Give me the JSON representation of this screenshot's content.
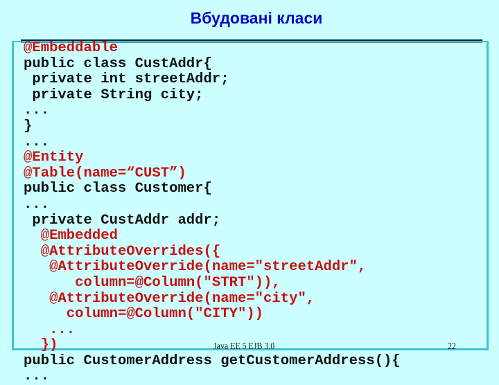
{
  "slide": {
    "title": "Вбудовані класи",
    "code_lines": [
      {
        "indent": "",
        "at": "@",
        "text": "Embeddable",
        "color": "red"
      },
      {
        "indent": "",
        "at": "",
        "text": "public class CustAddr{",
        "color": "black"
      },
      {
        "indent": " ",
        "at": "",
        "text": "private int streetAddr;",
        "color": "black"
      },
      {
        "indent": " ",
        "at": "",
        "text": "private String city;",
        "color": "black"
      },
      {
        "indent": "",
        "at": "",
        "text": "...",
        "color": "black"
      },
      {
        "indent": "",
        "at": "",
        "text": "}",
        "color": "black"
      },
      {
        "indent": "",
        "at": "",
        "text": "...",
        "color": "black"
      },
      {
        "indent": "",
        "at": "@",
        "text": "Entity",
        "color": "red"
      },
      {
        "indent": "",
        "at": "@",
        "text": "Table(name=“CUST”)",
        "color": "red"
      },
      {
        "indent": "",
        "at": "",
        "text": "public class Customer{",
        "color": "black"
      },
      {
        "indent": "",
        "at": "",
        "text": "...",
        "color": "black"
      },
      {
        "indent": " ",
        "at": "",
        "text": "private CustAddr addr;",
        "color": "black"
      },
      {
        "indent": "  ",
        "at": "@",
        "text": "Embedded",
        "color": "red"
      },
      {
        "indent": "  ",
        "at": "@",
        "text": "AttributeOverrides({",
        "color": "red"
      },
      {
        "indent": "   ",
        "at": "@",
        "text": "AttributeOverride(name=\"streetAddr\",",
        "color": "red"
      },
      {
        "indent": "      ",
        "at": "",
        "text": "column=@Column(\"STRT\")),",
        "color": "red"
      },
      {
        "indent": "   ",
        "at": "@",
        "text": "AttributeOverride(name=\"city\",",
        "color": "red"
      },
      {
        "indent": "     ",
        "at": "",
        "text": "column=@Column(\"CITY\"))",
        "color": "red"
      },
      {
        "indent": "   ",
        "at": "",
        "text": "...",
        "color": "red"
      },
      {
        "indent": "  ",
        "at": "",
        "text": "})",
        "color": "red"
      },
      {
        "indent": "",
        "at": "",
        "text": "public CustomerAddress getCustomerAddress(){",
        "color": "black"
      },
      {
        "indent": "",
        "at": "",
        "text": "...",
        "color": "black"
      }
    ]
  },
  "footer": {
    "caption": "Java EE 5 EJB 3.0",
    "page_number": "22"
  },
  "colors": {
    "background": "#ccffff",
    "title": "#0a0ac8",
    "annotation": "#cc1010",
    "code": "#111111",
    "box_border": "#3cc3d3"
  }
}
